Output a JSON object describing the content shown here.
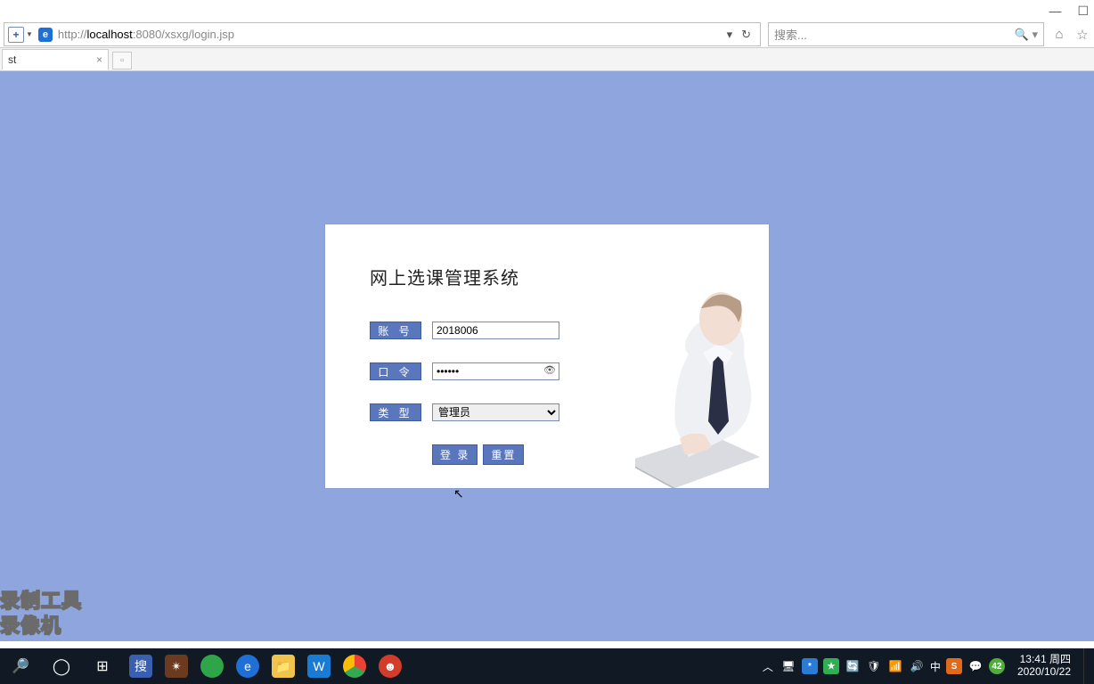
{
  "window": {
    "minimize": "—",
    "maximize": "☐",
    "close": "✕"
  },
  "browser": {
    "url_prefix": "http://",
    "url_host": "localhost",
    "url_port_path": ":8080/xsxg/login.jsp",
    "refresh": "↻",
    "search_placeholder": "搜索...",
    "search_icon": "🔍",
    "search_drop": "▾",
    "home_icon": "⌂",
    "star_icon": "☆"
  },
  "tab": {
    "title": "st",
    "close": "×",
    "new": "▫"
  },
  "login": {
    "title": "网上选课管理系统",
    "account_label": "账 号",
    "account_value": "2018006",
    "password_label": "口 令",
    "password_value": "••••••",
    "type_label": "类 型",
    "type_value": "管理员",
    "login_btn": "登 录",
    "reset_btn": "重置"
  },
  "watermark": {
    "line1": "录制工具",
    "line2": "录像机"
  },
  "taskbar": {
    "time": "13:41",
    "day": "周四",
    "date": "2020/10/22",
    "ime": "中",
    "tray": {
      "up": "︿",
      "badge42": "42"
    }
  }
}
